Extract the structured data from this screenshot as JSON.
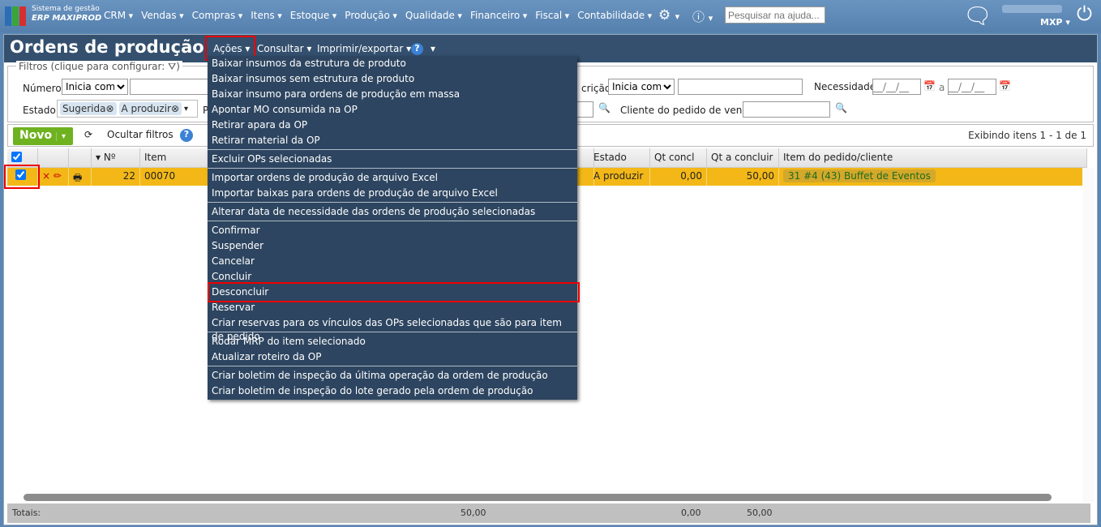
{
  "brand": {
    "line1": "Sistema de gestão",
    "line2": "ERP MAXIPROD"
  },
  "nav": [
    "CRM",
    "Vendas",
    "Compras",
    "Itens",
    "Estoque",
    "Produção",
    "Qualidade",
    "Financeiro",
    "Fiscal",
    "Contabilidade"
  ],
  "search_placeholder": "Pesquisar na ajuda...",
  "user": {
    "company": "MXP"
  },
  "page_title": "Ordens de produção",
  "title_menu": {
    "acoes": "Ações",
    "consultar": "Consultar",
    "imprimir": "Imprimir/exportar"
  },
  "filters": {
    "legend": "Filtros (clique para configurar:",
    "legend_end": ")",
    "numero": "Número",
    "numero_op": "Inicia com",
    "estado": "Estado",
    "estado_chips": [
      "Sugerida",
      "A produzir"
    ],
    "p_label": "P",
    "descricao": "crição",
    "descricao_op": "Inicia com",
    "necessidade": "Necessidade",
    "date_placeholder": "__/__/__",
    "a": "a",
    "cliente": "Cliente do pedido de venda"
  },
  "toolbar": {
    "novo": "Novo",
    "ocultar": "Ocultar filtros",
    "exibindo": "Exibindo itens 1 - 1 de 1"
  },
  "columns": {
    "no": "Nº",
    "item": "Item",
    "estado": "Estado",
    "qt_concl": "Qt concl",
    "qt_a_concluir": "Qt a concluir",
    "item_pedido": "Item do pedido/cliente"
  },
  "row": {
    "no": "22",
    "item": "00070",
    "estado": "A produzir",
    "qt_concl": "0,00",
    "qt_a_concluir": "50,00",
    "item_pedido": "31 #4 (43) Buffet de Eventos"
  },
  "totals": {
    "label": "Totais:",
    "v1": "50,00",
    "v2": "0,00",
    "v3": "50,00"
  },
  "menu": [
    [
      "Baixar insumos da estrutura de produto",
      "Baixar insumos sem estrutura de produto",
      "Baixar insumo para ordens de produção em massa",
      "Apontar MO consumida na OP",
      "Retirar apara da OP",
      "Retirar material da OP"
    ],
    [
      "Excluir OPs selecionadas"
    ],
    [
      "Importar ordens de produção de arquivo Excel",
      "Importar baixas para ordens de produção de arquivo Excel"
    ],
    [
      "Alterar data de necessidade das ordens de produção selecionadas"
    ],
    [
      "Confirmar",
      "Suspender",
      "Cancelar",
      "Concluir",
      "Desconcluir",
      "Reservar",
      "Criar reservas para os vínculos das OPs selecionadas que são para item de pedido"
    ],
    [
      "Rodar MRP do item selecionado",
      "Atualizar roteiro da OP"
    ],
    [
      "Criar boletim de inspeção da última operação da ordem de produção",
      "Criar boletim de inspeção do lote gerado pela ordem de produção"
    ]
  ]
}
